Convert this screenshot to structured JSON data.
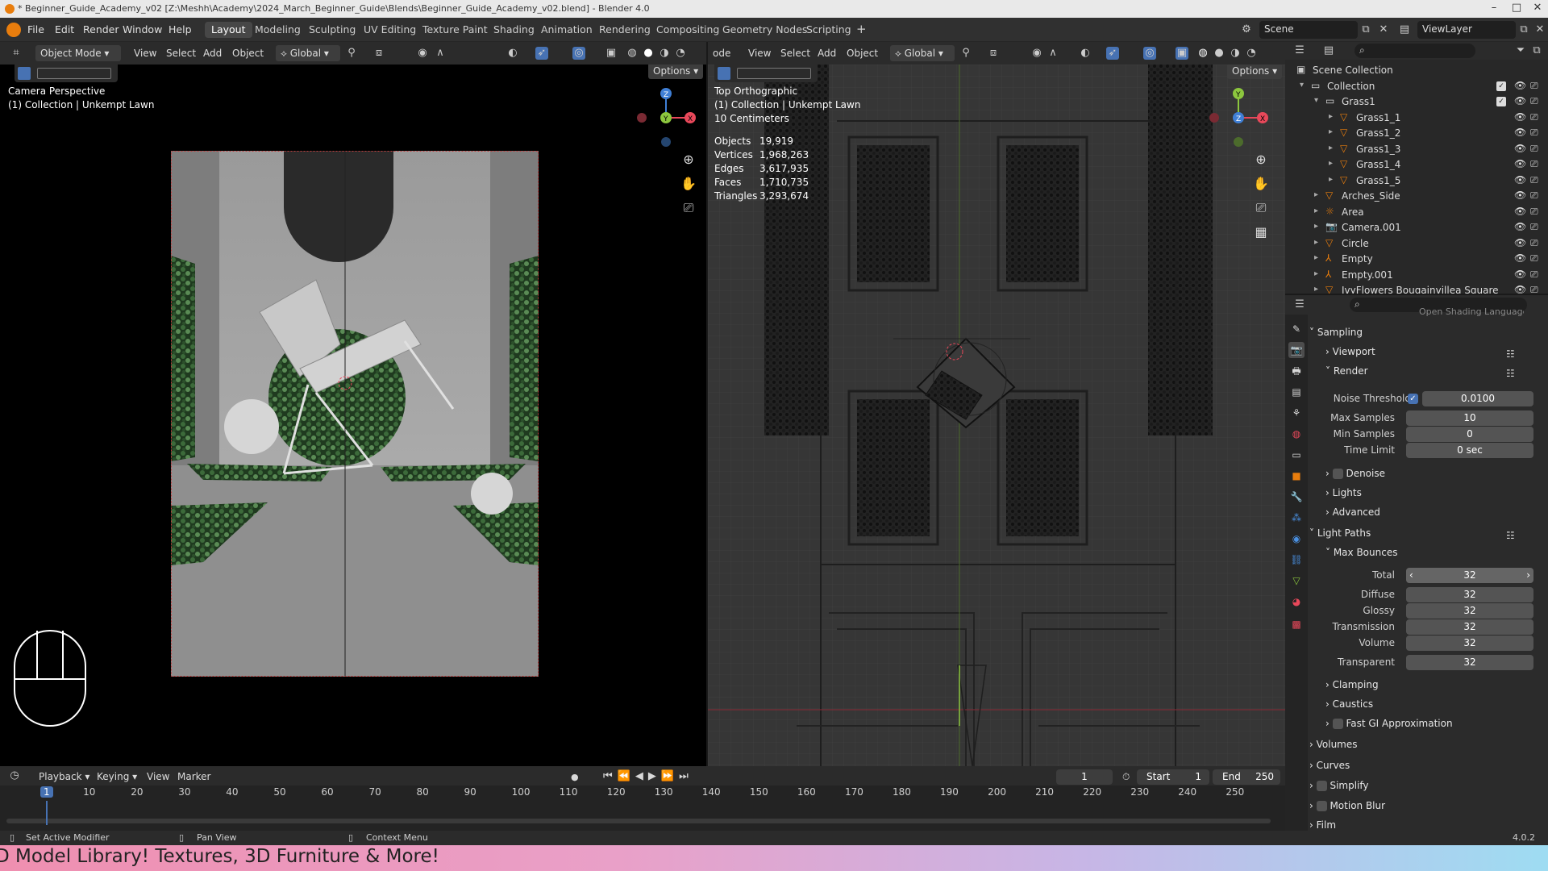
{
  "window": {
    "title": "* Beginner_Guide_Academy_v02 [Z:\\Meshh\\Academy\\2024_March_Beginner_Guide\\Blends\\Beginner_Guide_Academy_v02.blend] - Blender 4.0"
  },
  "menu": [
    "File",
    "Edit",
    "Render",
    "Window",
    "Help"
  ],
  "workspaces": [
    "Layout",
    "Modeling",
    "Sculpting",
    "UV Editing",
    "Texture Paint",
    "Shading",
    "Animation",
    "Rendering",
    "Compositing",
    "Geometry Nodes",
    "Scripting"
  ],
  "scene": {
    "name": "Scene",
    "view_layer": "ViewLayer"
  },
  "left_header": {
    "mode": "Object Mode",
    "menus": [
      "View",
      "Select",
      "Add",
      "Object"
    ],
    "transform": "Global",
    "options": "Options"
  },
  "right_header": {
    "mode_stub": "ode",
    "menus": [
      "View",
      "Select",
      "Add",
      "Object"
    ],
    "transform": "Global",
    "options": "Options"
  },
  "viewport_left": {
    "view": "Camera Perspective",
    "collection": "(1) Collection | Unkempt Lawn"
  },
  "viewport_right": {
    "view": "Top Orthographic",
    "collection": "(1) Collection | Unkempt Lawn",
    "scale": "10 Centimeters",
    "stats": [
      {
        "label": "Objects",
        "value": "19,919"
      },
      {
        "label": "Vertices",
        "value": "1,968,263"
      },
      {
        "label": "Edges",
        "value": "3,617,935"
      },
      {
        "label": "Faces",
        "value": "1,710,735"
      },
      {
        "label": "Triangles",
        "value": "3,293,674"
      }
    ]
  },
  "gizmo": {
    "x": "X",
    "y": "Y",
    "z": "Z"
  },
  "outliner": {
    "rows": [
      {
        "label": "Scene Collection",
        "indent": 0
      },
      {
        "label": "Collection",
        "indent": 1
      },
      {
        "label": "Grass1",
        "indent": 2
      },
      {
        "label": "Grass1_1",
        "indent": 3
      },
      {
        "label": "Grass1_2",
        "indent": 3
      },
      {
        "label": "Grass1_3",
        "indent": 3
      },
      {
        "label": "Grass1_4",
        "indent": 3
      },
      {
        "label": "Grass1_5",
        "indent": 3
      },
      {
        "label": "Arches_Side",
        "indent": 2
      },
      {
        "label": "Area",
        "indent": 2
      },
      {
        "label": "Camera.001",
        "indent": 2
      },
      {
        "label": "Circle",
        "indent": 2
      },
      {
        "label": "Empty",
        "indent": 2
      },
      {
        "label": "Empty.001",
        "indent": 2
      },
      {
        "label": "IvyFlowers Bougainvillea Square",
        "indent": 2
      }
    ]
  },
  "properties": {
    "partial_top": "Open Shading Language",
    "sampling": "Sampling",
    "viewport": "Viewport",
    "render": "Render",
    "noise_threshold": {
      "label": "Noise Threshold",
      "value": "0.0100"
    },
    "max_samples": {
      "label": "Max Samples",
      "value": "10"
    },
    "min_samples": {
      "label": "Min Samples",
      "value": "0"
    },
    "time_limit": {
      "label": "Time Limit",
      "value": "0 sec"
    },
    "denoise": "Denoise",
    "lights": "Lights",
    "advanced": "Advanced",
    "light_paths": "Light Paths",
    "max_bounces": "Max Bounces",
    "total": {
      "label": "Total",
      "value": "32"
    },
    "diffuse": {
      "label": "Diffuse",
      "value": "32"
    },
    "glossy": {
      "label": "Glossy",
      "value": "32"
    },
    "transmission": {
      "label": "Transmission",
      "value": "32"
    },
    "volume": {
      "label": "Volume",
      "value": "32"
    },
    "transparent": {
      "label": "Transparent",
      "value": "32"
    },
    "clamping": "Clamping",
    "caustics": "Caustics",
    "fast_gi": "Fast GI Approximation",
    "volumes": "Volumes",
    "curves": "Curves",
    "simplify": "Simplify",
    "motion_blur": "Motion Blur",
    "film": "Film"
  },
  "timeline": {
    "menus": [
      "Playback",
      "Keying",
      "View",
      "Marker"
    ],
    "current_frame": "1",
    "start_label": "Start",
    "start": "1",
    "end_label": "End",
    "end": "250",
    "ticks": [
      "1",
      "10",
      "20",
      "30",
      "40",
      "50",
      "60",
      "70",
      "80",
      "90",
      "100",
      "110",
      "120",
      "130",
      "140",
      "150",
      "160",
      "170",
      "180",
      "190",
      "200",
      "210",
      "220",
      "230",
      "240",
      "250"
    ]
  },
  "status": {
    "left": "Set Active Modifier",
    "mid": "Pan View",
    "right": "Context Menu",
    "version": "4.0.2"
  },
  "banner": {
    "text": "D Model Library! Textures, 3D Furniture & More!"
  },
  "colors": {
    "accent": "#4772b3",
    "x_axis": "#e8485a",
    "y_axis": "#8cc63e",
    "z_axis": "#3f7fd6"
  }
}
